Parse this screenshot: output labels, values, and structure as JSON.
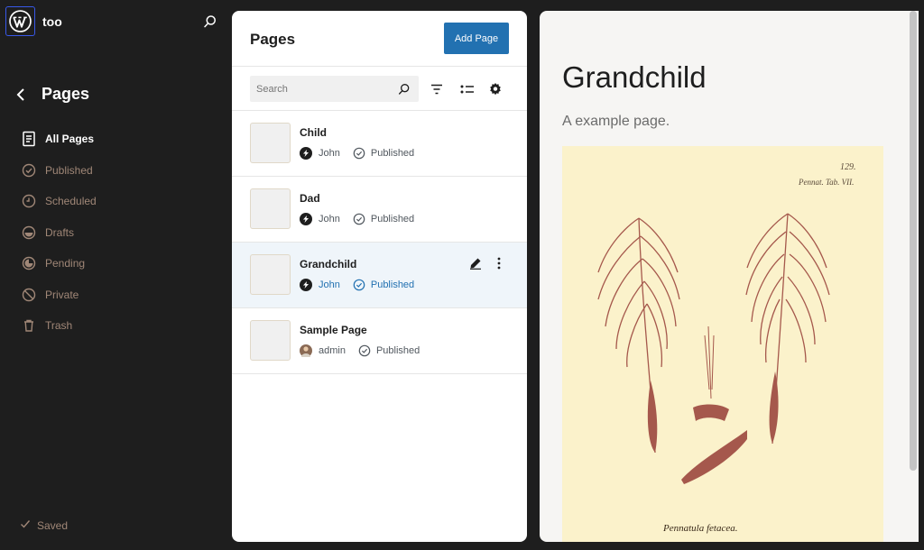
{
  "site": {
    "title": "too"
  },
  "sidebar": {
    "title": "Pages",
    "items": [
      {
        "label": "All Pages",
        "icon": "pages-icon",
        "active": true
      },
      {
        "label": "Published",
        "icon": "published-icon"
      },
      {
        "label": "Scheduled",
        "icon": "scheduled-icon"
      },
      {
        "label": "Drafts",
        "icon": "drafts-icon"
      },
      {
        "label": "Pending",
        "icon": "pending-icon"
      },
      {
        "label": "Private",
        "icon": "private-icon"
      },
      {
        "label": "Trash",
        "icon": "trash-icon"
      }
    ],
    "saved_label": "Saved"
  },
  "list": {
    "title": "Pages",
    "add_label": "Add Page",
    "search_placeholder": "Search",
    "rows": [
      {
        "title": "Child",
        "author": "John",
        "status": "Published"
      },
      {
        "title": "Dad",
        "author": "John",
        "status": "Published"
      },
      {
        "title": "Grandchild",
        "author": "John",
        "status": "Published",
        "selected": true
      },
      {
        "title": "Sample Page",
        "author": "admin",
        "status": "Published"
      }
    ]
  },
  "preview": {
    "title": "Grandchild",
    "subtitle": "A example page.",
    "image_caption": "Pennatula fetacea.",
    "image_plate": "Pennat. Tab. VII.",
    "image_number": "129."
  },
  "colors": {
    "accent": "#2271b1",
    "sidebar_bg": "#1e1e1e",
    "muted_text": "#a08777",
    "selected_row": "#eff5fa"
  }
}
